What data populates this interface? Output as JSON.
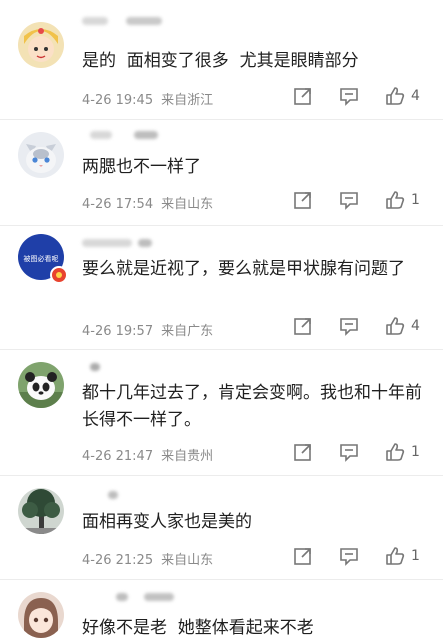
{
  "comments": [
    {
      "text": "是的  面相变了很多  尤其是眼睛部分",
      "time": "4-26 19:45",
      "location": "来自浙江",
      "likes": "4",
      "avatar": "avatar-sailor-girl"
    },
    {
      "text": "两腮也不一样了",
      "time": "4-26 17:54",
      "location": "来自山东",
      "likes": "1",
      "avatar": "avatar-cat"
    },
    {
      "text": "要么就是近视了，要么就是甲状腺有问题了",
      "time": "4-26 19:57",
      "location": "来自广东",
      "likes": "4",
      "avatar": "avatar-badge",
      "avatar_text": "被图必看呢"
    },
    {
      "text": "都十几年过去了，肯定会变啊。我也和十年前长得不一样了。",
      "time": "4-26 21:47",
      "location": "来自贵州",
      "likes": "1",
      "avatar": "avatar-panda"
    },
    {
      "text": "面相再变人家也是美的",
      "time": "4-26 21:25",
      "location": "来自山东",
      "likes": "1",
      "avatar": "avatar-tree"
    },
    {
      "text": "好像不是老  她整体看起来不老",
      "time": "",
      "location": "",
      "likes": "",
      "avatar": "avatar-anime-girl"
    }
  ],
  "icons": {
    "share": "share-icon",
    "reply": "comment-icon",
    "like": "thumb-up-icon"
  },
  "colors": {
    "text": "#1f1f1f",
    "meta": "#8a8a8a",
    "icon": "#777777",
    "divider": "#ececec"
  }
}
